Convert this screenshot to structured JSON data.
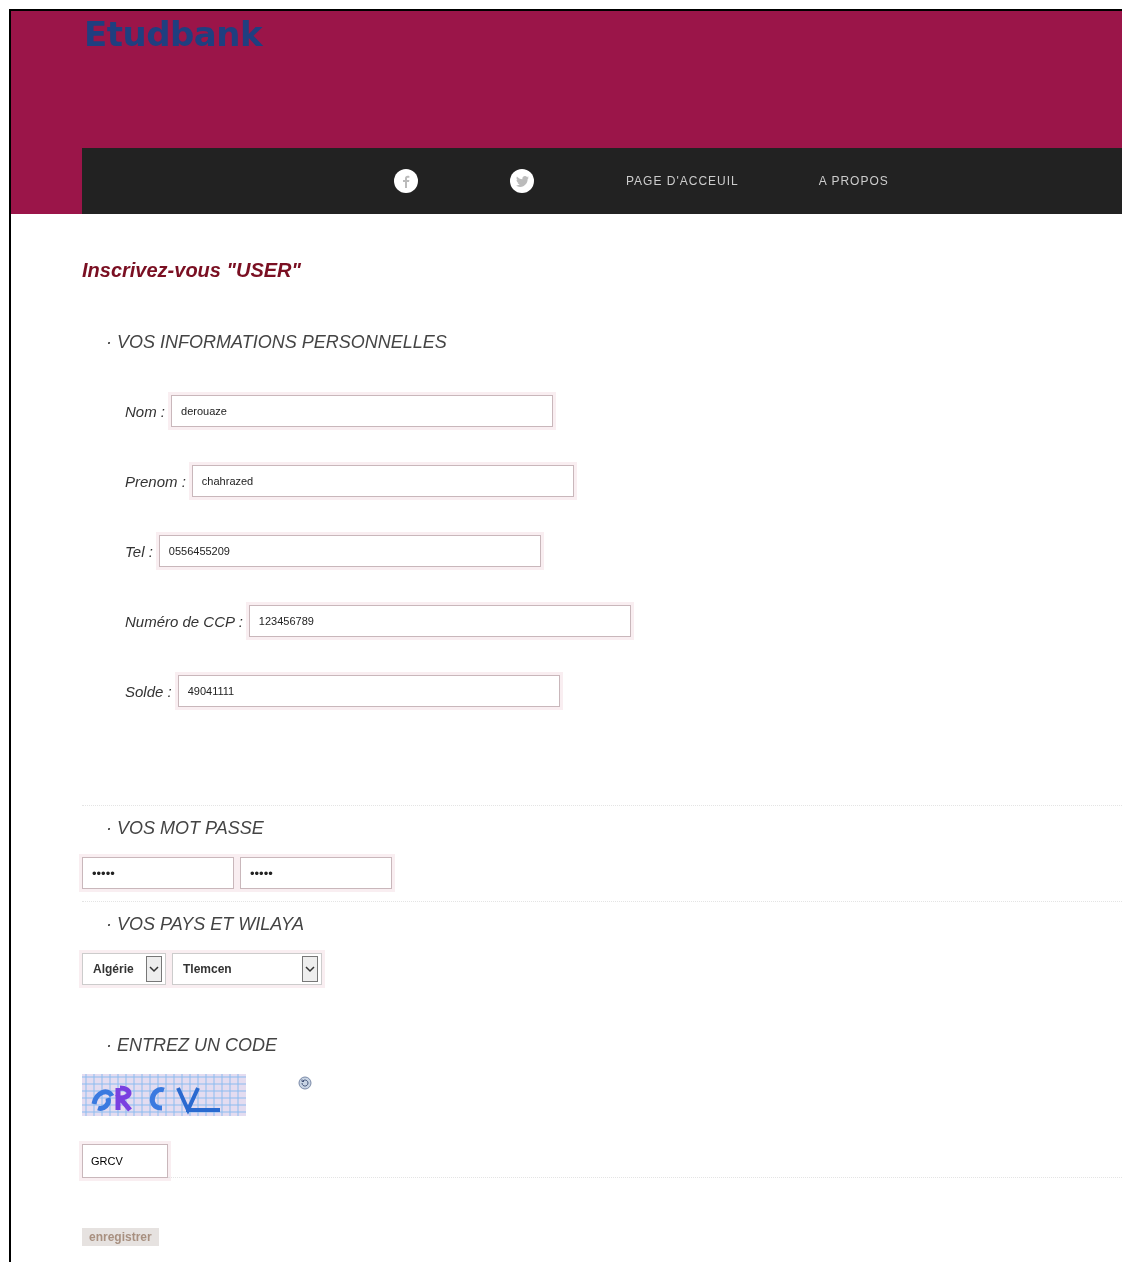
{
  "header": {
    "logo": "Etudbank"
  },
  "nav": {
    "social": [
      {
        "kind": "facebook"
      },
      {
        "kind": "twitter"
      }
    ],
    "links": [
      "PAGE D'ACCEUIL",
      "A PROPOS"
    ]
  },
  "title": "Inscrivez-vous \"USER\"",
  "sections": [
    {
      "kind": "fields",
      "heading": "· VOS INFORMATIONS PERSONNELLES",
      "fields": [
        {
          "label": "Nom :",
          "value": "derouaze"
        },
        {
          "label": "Prenom :",
          "value": "chahrazed"
        },
        {
          "label": "Tel :",
          "value": "0556455209"
        },
        {
          "label": "Numéro de CCP :",
          "value": "123456789"
        },
        {
          "label": "Solde :",
          "value": "49041111"
        }
      ]
    },
    {
      "kind": "passwords",
      "heading": "· VOS MOT PASSE",
      "values": [
        "•••••",
        "•••••"
      ]
    },
    {
      "kind": "selects",
      "heading": "· VOS PAYS ET WILAYA",
      "values": [
        "Algérie",
        "Tlemcen"
      ]
    },
    {
      "kind": "captcha",
      "heading": "· ENTREZ UN CODE",
      "value": "GRCV"
    }
  ],
  "submit": "enregistrer"
}
